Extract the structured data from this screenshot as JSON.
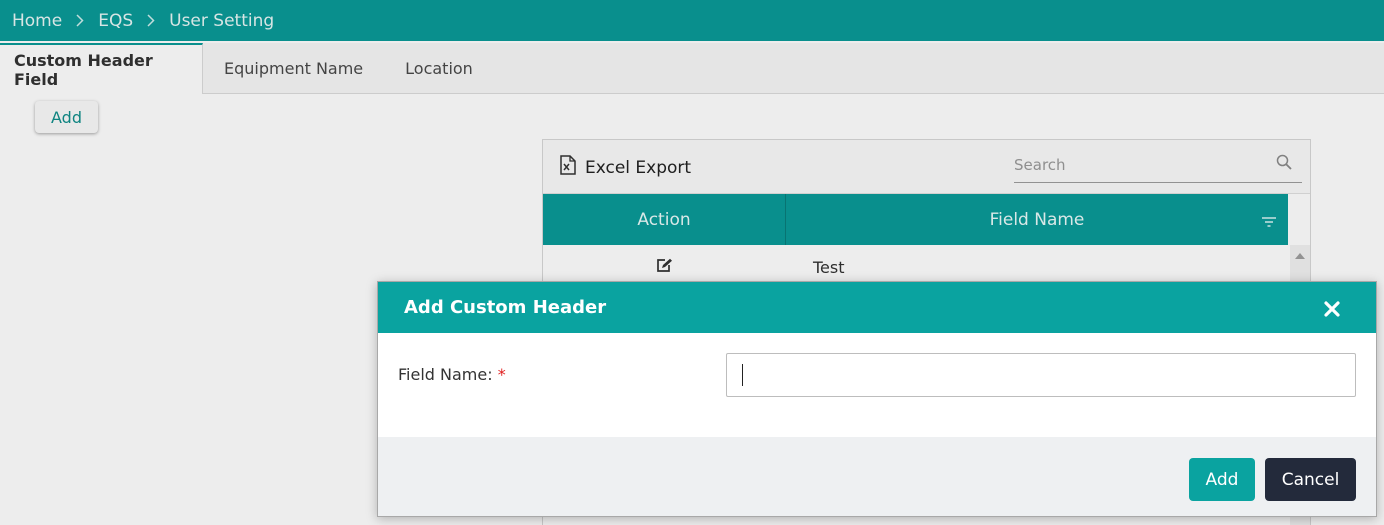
{
  "breadcrumb": {
    "items": [
      "Home",
      "EQS",
      "User Setting"
    ]
  },
  "tabs": [
    {
      "label": "Custom Header Field",
      "active": true
    },
    {
      "label": "Equipment Name",
      "active": false
    },
    {
      "label": "Location",
      "active": false
    }
  ],
  "page": {
    "add_label": "Add"
  },
  "grid": {
    "excel_export_label": "Excel Export",
    "search_placeholder": "Search",
    "columns": [
      "Action",
      "Field Name"
    ],
    "rows": [
      {
        "field_name": "Test"
      }
    ]
  },
  "modal": {
    "title": "Add Custom Header",
    "field_label": "Field Name:",
    "required_marker": "*",
    "field_value": "",
    "add_label": "Add",
    "cancel_label": "Cancel"
  },
  "colors": {
    "accent": "#0a9a98",
    "modal_header": "#0aa3a0",
    "cancel_button": "#232a3b",
    "required": "#e02020"
  },
  "icons": {
    "breadcrumb_separator": "chevron-right-icon",
    "excel_export": "excel-icon",
    "search": "search-icon",
    "column_filter": "filter-icon",
    "row_edit": "edit-icon",
    "modal_close": "close-icon"
  }
}
